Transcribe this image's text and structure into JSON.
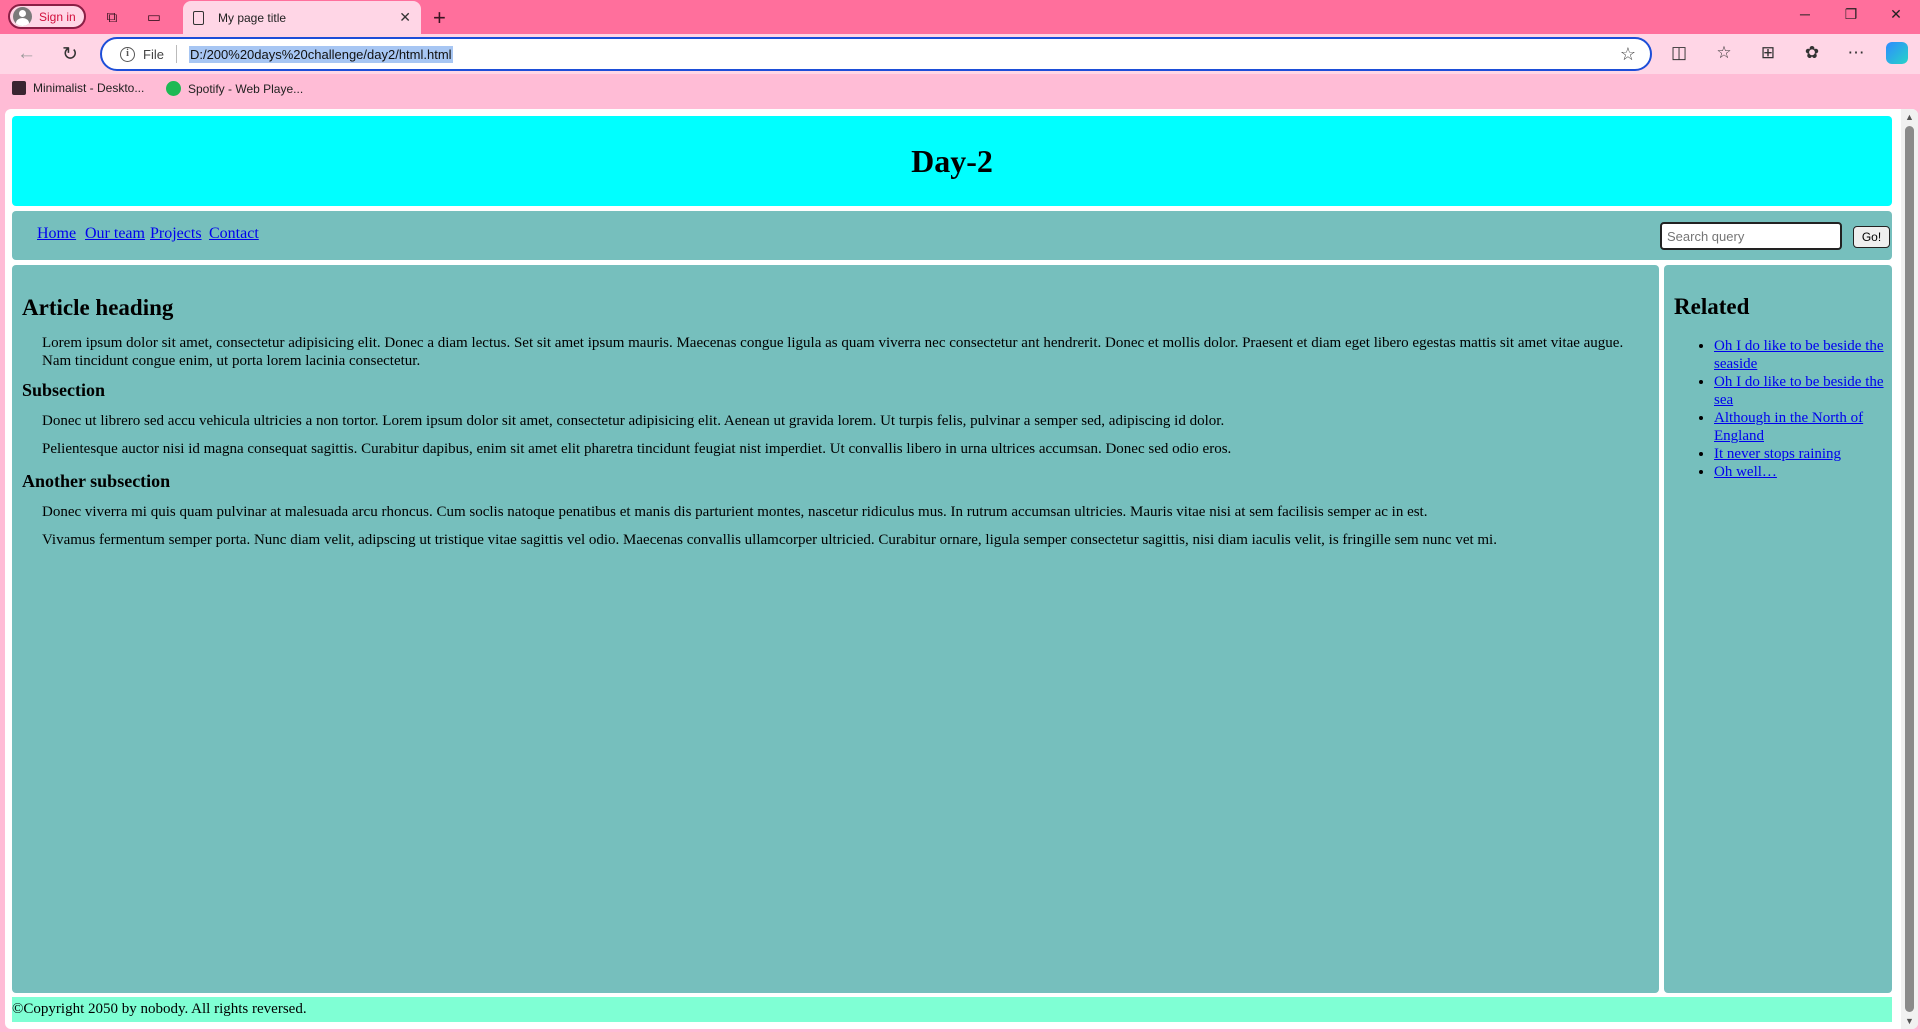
{
  "browser": {
    "profile_label": "Sign in",
    "tab_title": "My page title",
    "new_tab": "+",
    "omnibox": {
      "scheme": "File",
      "url": "D:/200%20days%20challenge/day2/html.html"
    },
    "bookmarks": [
      {
        "label": "Minimalist - Deskto..."
      },
      {
        "label": "Spotify - Web Playe..."
      }
    ]
  },
  "page": {
    "header_title": "Day-2",
    "nav": [
      "Home",
      "Our team",
      "Projects",
      "Contact"
    ],
    "search": {
      "placeholder": "Search query",
      "button": "Go!"
    },
    "article": {
      "heading": "Article heading",
      "intro": "Lorem ipsum dolor sit amet, consectetur adipisicing elit. Donec a diam lectus. Set sit amet ipsum mauris. Maecenas congue ligula as quam viverra nec consectetur ant hendrerit. Donec et mollis dolor. Praesent et diam eget libero egestas mattis sit amet vitae augue. Nam tincidunt congue enim, ut porta lorem lacinia consectetur.",
      "subsection_heading": "Subsection",
      "subsection_p1": "Donec ut librero sed accu vehicula ultricies a non tortor. Lorem ipsum dolor sit amet, consectetur adipisicing elit. Aenean ut gravida lorem. Ut turpis felis, pulvinar a semper sed, adipiscing id dolor.",
      "subsection_p2": "Pelientesque auctor nisi id magna consequat sagittis. Curabitur dapibus, enim sit amet elit pharetra tincidunt feugiat nist imperdiet. Ut convallis libero in urna ultrices accumsan. Donec sed odio eros.",
      "another_heading": "Another subsection",
      "another_p1": "Donec viverra mi quis quam pulvinar at malesuada arcu rhoncus. Cum soclis natoque penatibus et manis dis parturient montes, nascetur ridiculus mus. In rutrum accumsan ultricies. Mauris vitae nisi at sem facilisis semper ac in est.",
      "another_p2": "Vivamus fermentum semper porta. Nunc diam velit, adipscing ut tristique vitae sagittis vel odio. Maecenas convallis ullamcorper ultricied. Curabitur ornare, ligula semper consectetur sagittis, nisi diam iaculis velit, is fringille sem nunc vet mi."
    },
    "related": {
      "heading": "Related",
      "links": [
        "Oh I do like to be beside the seaside",
        "Oh I do like to be beside the sea",
        "Although in the North of England",
        "It never stops raining",
        "Oh well…"
      ]
    },
    "footer": "©Copyright 2050 by nobody. All rights reversed."
  },
  "colors": {
    "header_bg": "#00ffff",
    "section_bg": "#76bfbd",
    "footer_bg": "#7fffd4",
    "chrome_tabbar": "#ff6f9c",
    "chrome_toolbar": "#ffd6e6"
  },
  "icons": [
    "user-icon",
    "workspaces-icon",
    "tab-actions-icon",
    "page-icon",
    "close-icon",
    "plus-icon",
    "minimize-icon",
    "restore-icon",
    "back-icon",
    "reload-icon",
    "info-icon",
    "star-icon",
    "split-screen-icon",
    "favorites-icon",
    "collections-icon",
    "extensions-icon",
    "more-icon",
    "copilot-icon"
  ]
}
